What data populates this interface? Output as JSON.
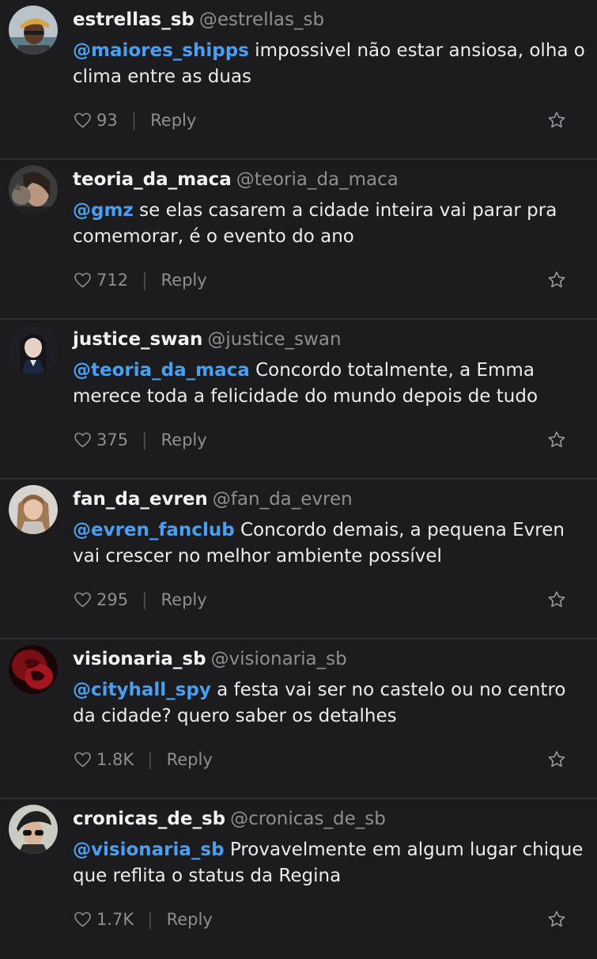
{
  "comments": [
    {
      "username": "estrellas_sb",
      "handle": "@estrellas_sb",
      "mention": "@maiores_shipps",
      "text": " impossivel não estar ansiosa, olha o clima entre as duas",
      "likes": "93",
      "reply_label": "Reply"
    },
    {
      "username": "teoria_da_maca",
      "handle": "@teoria_da_maca",
      "mention": "@gmz",
      "text": " se elas casarem a cidade inteira vai parar pra comemorar, é o evento do ano",
      "likes": "712",
      "reply_label": "Reply"
    },
    {
      "username": "justice_swan",
      "handle": "@justice_swan",
      "mention": "@teoria_da_maca",
      "text": " Concordo totalmente, a Emma merece toda a felicidade do mundo depois de tudo",
      "likes": "375",
      "reply_label": "Reply"
    },
    {
      "username": "fan_da_evren",
      "handle": "@fan_da_evren",
      "mention": "@evren_fanclub",
      "text": " Concordo demais, a pequena Evren vai crescer no melhor ambiente possível",
      "likes": "295",
      "reply_label": "Reply"
    },
    {
      "username": "visionaria_sb",
      "handle": "@visionaria_sb",
      "mention": "@cityhall_spy",
      "text": " a festa vai ser no castelo ou no centro da cidade? quero saber os detalhes",
      "likes": "1.8K",
      "reply_label": "Reply"
    },
    {
      "username": "cronicas_de_sb",
      "handle": "@cronicas_de_sb",
      "mention": "@visionaria_sb",
      "text": " Provavelmente em algum lugar chique que reflita o status da Regina",
      "likes": "1.7K",
      "reply_label": "Reply"
    }
  ],
  "icons": {
    "like": "heart-outline-icon",
    "favorite": "star-outline-icon"
  },
  "colors": {
    "background": "#1c1c1e",
    "mention": "#4a9ff2",
    "muted": "#8e8e93",
    "separator": "#2e2e31"
  }
}
